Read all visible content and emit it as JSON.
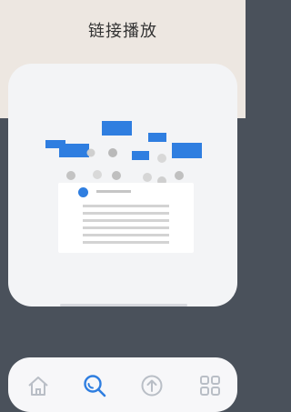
{
  "header": {
    "title": "链接播放"
  },
  "card": {
    "illustration": "link-playback-illustration"
  },
  "nav": {
    "items": [
      {
        "icon": "home-icon",
        "active": false
      },
      {
        "icon": "search-icon",
        "active": true
      },
      {
        "icon": "upload-icon",
        "active": false
      },
      {
        "icon": "apps-grid-icon",
        "active": false
      }
    ]
  },
  "colors": {
    "accent": "#2f7ee0",
    "header_bg": "#ede7e1",
    "page_bg": "#4a515b",
    "card_bg": "#f3f4f6",
    "nav_inactive": "#b9bec6"
  }
}
